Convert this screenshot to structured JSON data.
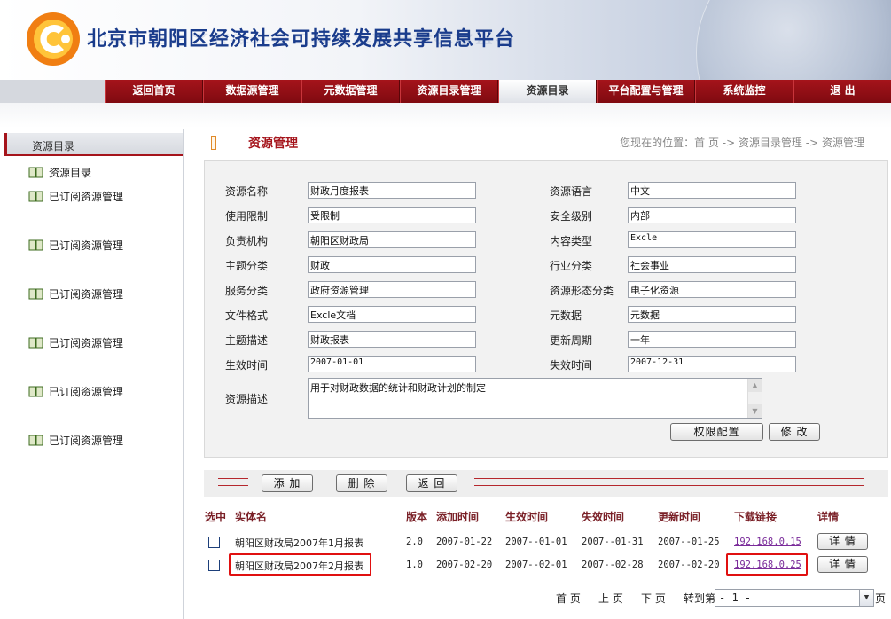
{
  "site": {
    "title": "北京市朝阳区经济社会可持续发展共享信息平台"
  },
  "nav": [
    {
      "label": "返回首页",
      "active": false
    },
    {
      "label": "数据源管理",
      "active": false
    },
    {
      "label": "元数据管理",
      "active": false
    },
    {
      "label": "资源目录管理",
      "active": false
    },
    {
      "label": "资源目录",
      "active": true
    },
    {
      "label": "平台配置与管理",
      "active": false
    },
    {
      "label": "系统监控",
      "active": false
    },
    {
      "label": "退  出",
      "active": false
    }
  ],
  "sidebar": {
    "title": "资源目录",
    "items": [
      {
        "label": "资源目录"
      },
      {
        "label": "已订阅资源管理"
      },
      {
        "label": "已订阅资源管理"
      },
      {
        "label": "已订阅资源管理"
      },
      {
        "label": "已订阅资源管理"
      },
      {
        "label": "已订阅资源管理"
      },
      {
        "label": "已订阅资源管理"
      }
    ]
  },
  "content": {
    "title": "资源管理",
    "breadcrumb": "您现在的位置：首 页 -> 资源目录管理 -> 资源管理"
  },
  "form": {
    "left": [
      {
        "label": "资源名称",
        "value": "财政月度报表"
      },
      {
        "label": "使用限制",
        "value": "受限制"
      },
      {
        "label": "负责机构",
        "value": "朝阳区财政局"
      },
      {
        "label": "主题分类",
        "value": "财政"
      },
      {
        "label": "服务分类",
        "value": "政府资源管理"
      },
      {
        "label": "文件格式",
        "value": "Excle文档"
      },
      {
        "label": "主题描述",
        "value": "财政报表"
      },
      {
        "label": "生效时间",
        "value": "2007-01-01"
      }
    ],
    "right": [
      {
        "label": "资源语言",
        "value": "中文"
      },
      {
        "label": "安全级别",
        "value": "内部"
      },
      {
        "label": "内容类型",
        "value": "Excle"
      },
      {
        "label": "行业分类",
        "value": "社会事业"
      },
      {
        "label": "资源形态分类",
        "value": "电子化资源"
      },
      {
        "label": "元数据",
        "value": "元数据"
      },
      {
        "label": "更新周期",
        "value": "一年"
      },
      {
        "label": "失效时间",
        "value": "2007-12-31"
      }
    ],
    "description": {
      "label": "资源描述",
      "value": "用于对财政数据的统计和财政计划的制定"
    },
    "buttons": {
      "permission": "权限配置",
      "modify": "修  改"
    }
  },
  "toolbar": {
    "add": "添  加",
    "delete": "删  除",
    "back": "返  回"
  },
  "table": {
    "headers": [
      "选中",
      "实体名",
      "版本",
      "添加时间",
      "生效时间",
      "失效时间",
      "更新时间",
      "下载链接",
      "详情"
    ],
    "rows": [
      {
        "name": "朝阳区财政局2007年1月报表",
        "version": "2.0",
        "added": "2007-01-22",
        "effective": "2007--01-01",
        "expire": "2007--01-31",
        "updated": "2007--01-25",
        "link": "192.168.0.15",
        "detail": "详  情"
      },
      {
        "name": "朝阳区财政局2007年2月报表",
        "version": "1.0",
        "added": "2007-02-20",
        "effective": "2007--02-01",
        "expire": "2007--02-28",
        "updated": "2007--02-20",
        "link": "192.168.0.25",
        "detail": "详  情"
      }
    ]
  },
  "pager": {
    "first": "首 页",
    "prev": "上 页",
    "next": "下 页",
    "goto": "转到第",
    "current": "- 1 -",
    "suffix": "页"
  },
  "colors": {
    "nav_red": "#a5141b",
    "title_blue": "#1a3c8c",
    "highlight_red": "#e01010",
    "link_purple": "#7a2b9a"
  }
}
